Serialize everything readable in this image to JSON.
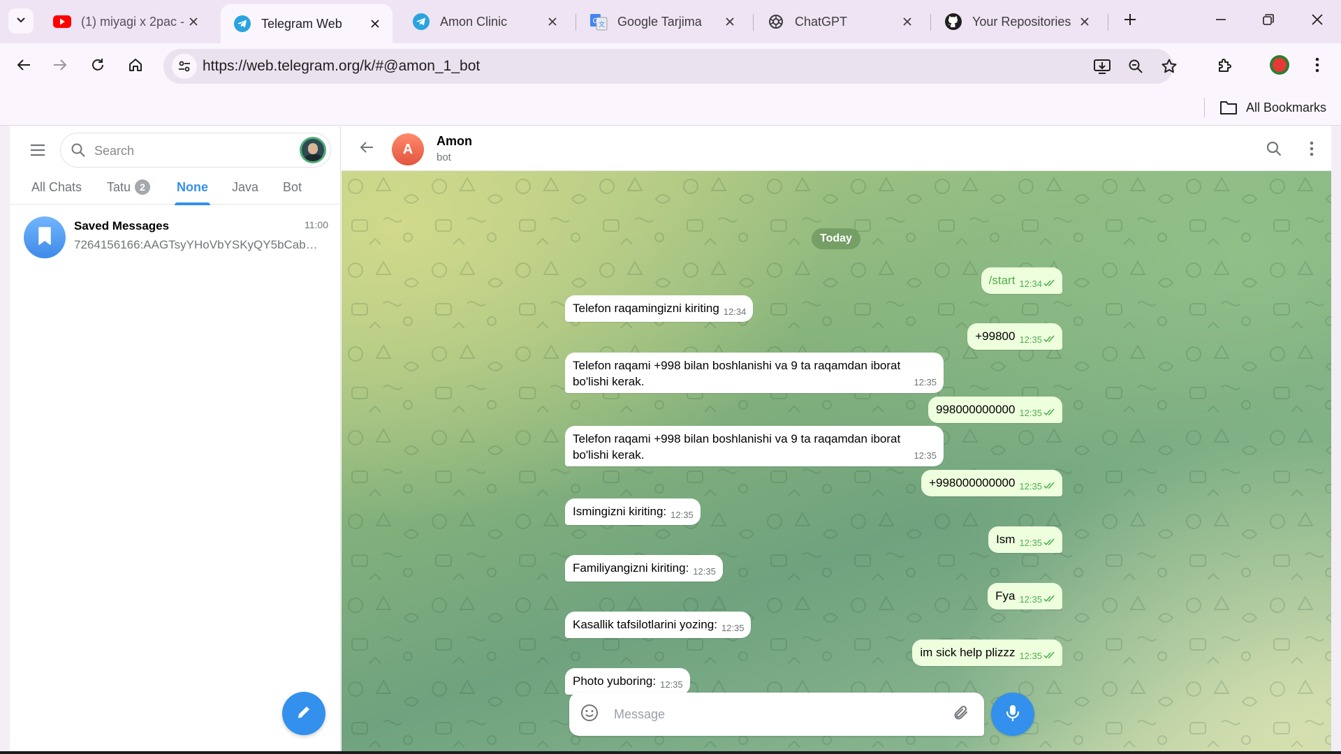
{
  "browser": {
    "tabs": [
      {
        "title": "(1) miyagi x 2pac -",
        "icon": "youtube-icon"
      },
      {
        "title": "Telegram Web",
        "icon": "telegram-icon",
        "active": true
      },
      {
        "title": "Amon Clinic",
        "icon": "telegram-icon"
      },
      {
        "title": "Google Tarjima",
        "icon": "google-translate-icon"
      },
      {
        "title": "ChatGPT",
        "icon": "chatgpt-icon"
      },
      {
        "title": "Your Repositories",
        "icon": "github-icon"
      }
    ],
    "url": "https://web.telegram.org/k/#@amon_1_bot",
    "all_bookmarks_label": "All Bookmarks",
    "accent_color": "#efe4f4"
  },
  "sidebar": {
    "search_placeholder": "Search",
    "folders": [
      {
        "label": "All Chats"
      },
      {
        "label": "Tatu",
        "badge": "2"
      },
      {
        "label": "None",
        "active": true
      },
      {
        "label": "Java"
      },
      {
        "label": "Bot"
      }
    ],
    "chats": [
      {
        "name": "Saved Messages",
        "time": "11:00",
        "preview": "7264156166:AAGTsyYHoVbYSKyQY5bCab…",
        "icon": "bookmark-icon"
      }
    ]
  },
  "chat": {
    "peer_initial": "A",
    "peer_name": "Amon",
    "peer_status": "bot",
    "date_separator": "Today",
    "composer_placeholder": "Message",
    "accent_color": "#3390ec",
    "messages": [
      {
        "dir": "out",
        "text": "/start",
        "time": "12:34",
        "read": true
      },
      {
        "dir": "in",
        "text": "Telefon raqamingizni kiriting",
        "time": "12:34"
      },
      {
        "dir": "out",
        "text": "+99800",
        "time": "12:35",
        "read": true
      },
      {
        "dir": "in",
        "text": "Telefon raqami +998 bilan boshlanishi va 9 ta raqamdan iborat bo'lishi kerak.",
        "time": "12:35"
      },
      {
        "dir": "out",
        "text": "998000000000",
        "time": "12:35",
        "read": true
      },
      {
        "dir": "in",
        "text": "Telefon raqami +998 bilan boshlanishi va 9 ta raqamdan iborat bo'lishi kerak.",
        "time": "12:35"
      },
      {
        "dir": "out",
        "text": "+998000000000",
        "time": "12:35",
        "read": true
      },
      {
        "dir": "in",
        "text": "Ismingizni kiriting:",
        "time": "12:35"
      },
      {
        "dir": "out",
        "text": "Ism",
        "time": "12:35",
        "read": true
      },
      {
        "dir": "in",
        "text": "Familiyangizni kiriting:",
        "time": "12:35"
      },
      {
        "dir": "out",
        "text": "Fya",
        "time": "12:35",
        "read": true
      },
      {
        "dir": "in",
        "text": "Kasallik tafsilotlarini yozing:",
        "time": "12:35"
      },
      {
        "dir": "out",
        "text": "im sick help plizzz",
        "time": "12:35",
        "read": true
      },
      {
        "dir": "in",
        "text": "Photo yuboring:",
        "time": "12:35"
      }
    ]
  }
}
